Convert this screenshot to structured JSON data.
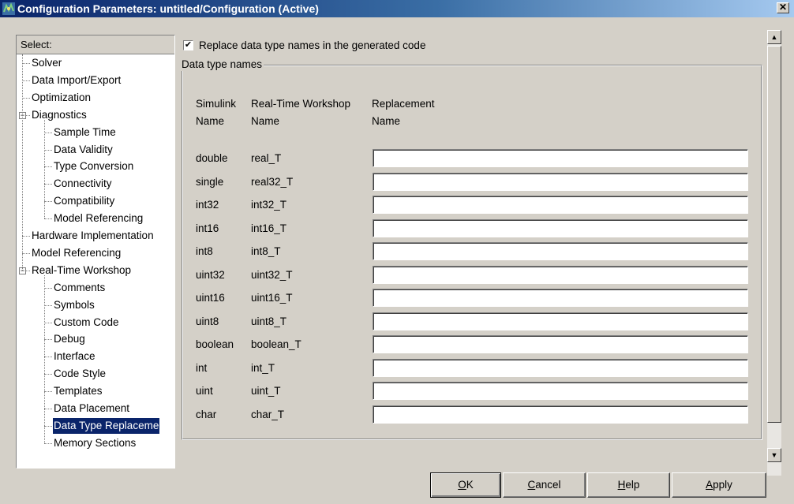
{
  "window": {
    "title": "Configuration Parameters: untitled/Configuration (Active)",
    "close_label": "✕"
  },
  "tree": {
    "header": "Select:",
    "items": [
      {
        "label": "Solver",
        "level": 0
      },
      {
        "label": "Data Import/Export",
        "level": 0
      },
      {
        "label": "Optimization",
        "level": 0
      },
      {
        "label": "Diagnostics",
        "level": 0,
        "expanded": true
      },
      {
        "label": "Sample Time",
        "level": 1
      },
      {
        "label": "Data Validity",
        "level": 1
      },
      {
        "label": "Type Conversion",
        "level": 1
      },
      {
        "label": "Connectivity",
        "level": 1
      },
      {
        "label": "Compatibility",
        "level": 1
      },
      {
        "label": "Model Referencing",
        "level": 1
      },
      {
        "label": "Hardware Implementation",
        "level": 0
      },
      {
        "label": "Model Referencing",
        "level": 0
      },
      {
        "label": "Real-Time Workshop",
        "level": 0,
        "expanded": true
      },
      {
        "label": "Comments",
        "level": 1
      },
      {
        "label": "Symbols",
        "level": 1
      },
      {
        "label": "Custom Code",
        "level": 1
      },
      {
        "label": "Debug",
        "level": 1
      },
      {
        "label": "Interface",
        "level": 1
      },
      {
        "label": "Code Style",
        "level": 1
      },
      {
        "label": "Templates",
        "level": 1
      },
      {
        "label": "Data Placement",
        "level": 1
      },
      {
        "label": "Data Type Replaceme",
        "level": 1,
        "selected": true
      },
      {
        "label": "Memory Sections",
        "level": 1
      }
    ]
  },
  "main": {
    "checkbox_label": "Replace data type names in the generated code",
    "checkbox_checked": true,
    "checkbox_mark": "✔",
    "group_title": "Data type names",
    "headers": {
      "simulink_line1": "Simulink",
      "simulink_line2": "Name",
      "rtw_line1": "Real-Time Workshop",
      "rtw_line2": "Name",
      "replacement_line1": "Replacement",
      "replacement_line2": "Name"
    },
    "rows": [
      {
        "simulink": "double",
        "rtw": "real_T",
        "replacement": ""
      },
      {
        "simulink": "single",
        "rtw": "real32_T",
        "replacement": ""
      },
      {
        "simulink": "int32",
        "rtw": "int32_T",
        "replacement": ""
      },
      {
        "simulink": "int16",
        "rtw": "int16_T",
        "replacement": ""
      },
      {
        "simulink": "int8",
        "rtw": "int8_T",
        "replacement": ""
      },
      {
        "simulink": "uint32",
        "rtw": "uint32_T",
        "replacement": ""
      },
      {
        "simulink": "uint16",
        "rtw": "uint16_T",
        "replacement": ""
      },
      {
        "simulink": "uint8",
        "rtw": "uint8_T",
        "replacement": ""
      },
      {
        "simulink": "boolean",
        "rtw": "boolean_T",
        "replacement": ""
      },
      {
        "simulink": "int",
        "rtw": "int_T",
        "replacement": ""
      },
      {
        "simulink": "uint",
        "rtw": "uint_T",
        "replacement": ""
      },
      {
        "simulink": "char",
        "rtw": "char_T",
        "replacement": ""
      }
    ]
  },
  "buttons": {
    "ok": {
      "mnemonic": "O",
      "rest": "K"
    },
    "cancel": {
      "mnemonic": "C",
      "rest": "ancel"
    },
    "help": {
      "mnemonic": "H",
      "rest": "elp"
    },
    "apply": {
      "mnemonic": "A",
      "rest": "pply"
    }
  },
  "scrollbar": {
    "up_arrow": "▲",
    "down_arrow": "▼"
  }
}
